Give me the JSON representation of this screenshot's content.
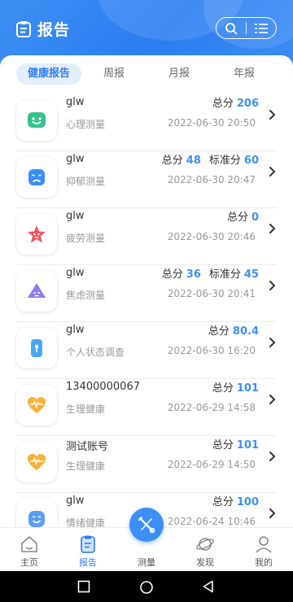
{
  "header": {
    "title": "报告"
  },
  "tabs": [
    "健康报告",
    "周报",
    "月报",
    "年报"
  ],
  "reports": [
    {
      "name": "glw",
      "type": "心理测量",
      "date": "2022-06-30 20:50",
      "scores": [
        {
          "label": "总分",
          "value": "206"
        }
      ],
      "icon": "smile-icon",
      "color": "#36c28a"
    },
    {
      "name": "glw",
      "type": "抑郁测量",
      "date": "2022-06-30 20:47",
      "scores": [
        {
          "label": "总分",
          "value": "48"
        },
        {
          "label": "标准分",
          "value": "60"
        }
      ],
      "icon": "sad-face-icon",
      "color": "#3d8ff5"
    },
    {
      "name": "glw",
      "type": "疲劳测量",
      "date": "2022-06-30 20:46",
      "scores": [
        {
          "label": "总分",
          "value": "0"
        }
      ],
      "icon": "star-icon",
      "color": "#f0545a"
    },
    {
      "name": "glw",
      "type": "焦虑测量",
      "date": "2022-06-30 20:41",
      "scores": [
        {
          "label": "总分",
          "value": "36"
        },
        {
          "label": "标准分",
          "value": "45"
        }
      ],
      "icon": "triangle-face-icon",
      "color": "#8e7cf0"
    },
    {
      "name": "glw",
      "type": "个人状态调查",
      "date": "2022-06-30 16:20",
      "scores": [
        {
          "label": "总分",
          "value": "80.4"
        }
      ],
      "icon": "survey-icon",
      "color": "#4aa8f0"
    },
    {
      "name": "13400000067",
      "type": "生理健康",
      "date": "2022-06-29 14:58",
      "scores": [
        {
          "label": "总分",
          "value": "101"
        }
      ],
      "icon": "heart-pulse-icon",
      "color": "#f7b23a"
    },
    {
      "name": "测试账号",
      "type": "生理健康",
      "date": "2022-06-29 14:50",
      "scores": [
        {
          "label": "总分",
          "value": "101"
        }
      ],
      "icon": "heart-pulse-icon",
      "color": "#f7b23a"
    },
    {
      "name": "glw",
      "type": "情绪健康",
      "date": "2022-06-24 10:46",
      "scores": [
        {
          "label": "总分",
          "value": "100"
        }
      ],
      "icon": "happy-face-icon",
      "color": "#5b9cf5"
    }
  ],
  "nav": [
    {
      "label": "主页",
      "icon": "home-icon"
    },
    {
      "label": "报告",
      "icon": "report-icon"
    },
    {
      "label": "测量",
      "icon": "measure-icon"
    },
    {
      "label": "发现",
      "icon": "discover-icon"
    },
    {
      "label": "我的",
      "icon": "profile-icon"
    }
  ]
}
